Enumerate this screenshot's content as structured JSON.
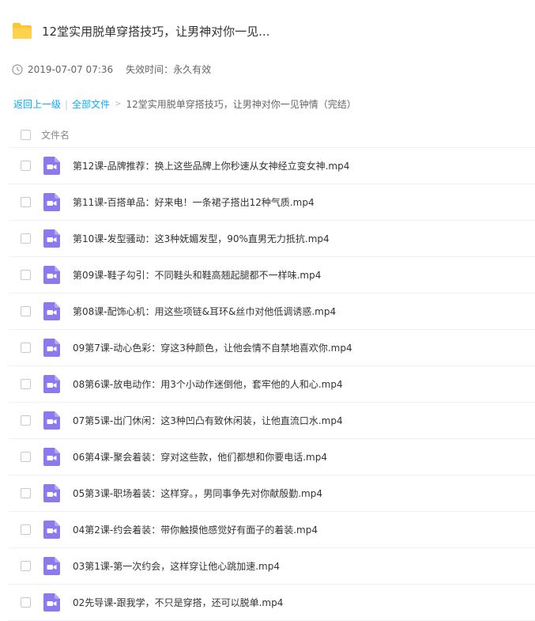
{
  "share": {
    "title": "12堂实用脱单穿搭技巧，让男神对你一见...",
    "date": "2019-07-07 07:36",
    "expire": "失效时间：永久有效"
  },
  "breadcrumb": {
    "back": "返回上一级",
    "all_files": "全部文件",
    "current": "12堂实用脱单穿搭技巧，让男神对你一见钟情（完结）"
  },
  "table": {
    "col_header": "文件名"
  },
  "files": [
    "第12课-品牌推荐：换上这些品牌上你秒速从女神经立变女神.mp4",
    "第11课-百搭单品：好来电！一条裙子搭出12种气质.mp4",
    "第10课-发型骚动：这3种妩媚发型，90%直男无力抵抗.mp4",
    "第09课-鞋子勾引：不同鞋头和鞋高翘起腿都不一样味.mp4",
    "第08课-配饰心机：用这些项链&耳环&丝巾对他低调诱惑.mp4",
    "09第7课-动心色彩：穿这3种颜色，让他会情不自禁地喜欢你.mp4",
    "08第6课-放电动作：用3个小动作迷倒他，套牢他的人和心.mp4",
    "07第5课-出门休闲：这3种凹凸有致休闲装，让他直流口水.mp4",
    "06第4课-聚会着装：穿对这些款，他们都想和你要电话.mp4",
    "05第3课-职场着装：这样穿。，男同事争先对你献殷勤.mp4",
    "04第2课-约会着装：带你触摸他感觉好有面子的着装.mp4",
    "03第1课-第一次约会，这样穿让他心跳加速.mp4",
    "02先导课-跟我学，不只是穿搭，还可以脱单.mp4"
  ],
  "colors": {
    "link": "#09AAFF",
    "video_icon": "#8C79EE",
    "folder": "#FFC52E"
  }
}
